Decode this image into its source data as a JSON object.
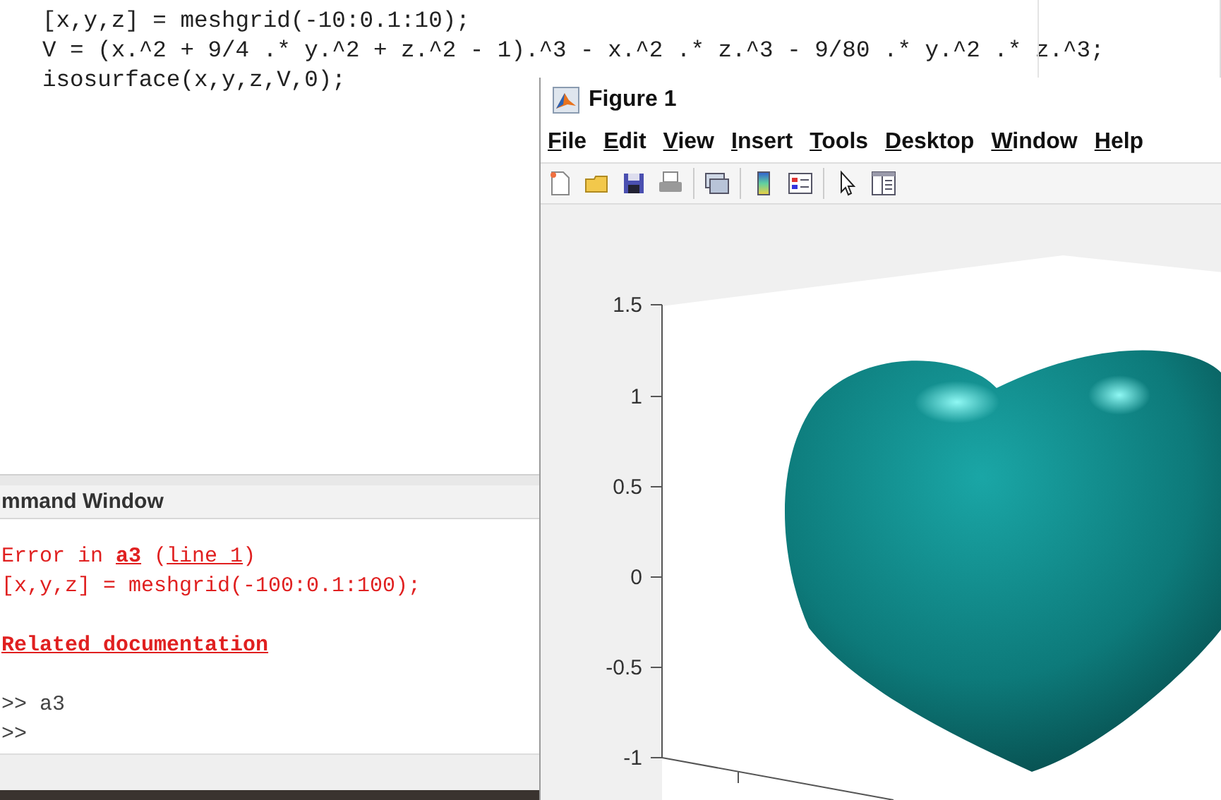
{
  "editor": {
    "lines": [
      "[x,y,z] = meshgrid(-10:0.1:10);",
      "V = (x.^2 + 9/4 .* y.^2 + z.^2 - 1).^3 - x.^2 .* z.^3 - 9/80 .* y.^2 .* z.^3;",
      "isosurface(x,y,z,V,0);"
    ]
  },
  "command_window": {
    "title": "mmand Window",
    "lines": [
      {
        "kind": "error",
        "segments": [
          {
            "text": "Error in ",
            "link": false,
            "bold": false
          },
          {
            "text": "a3",
            "link": true,
            "bold": true
          },
          {
            "text": " (",
            "link": false,
            "bold": false
          },
          {
            "text": "line 1",
            "link": true,
            "bold": false
          },
          {
            "text": ")",
            "link": false,
            "bold": false
          }
        ]
      },
      {
        "kind": "error",
        "segments": [
          {
            "text": "[x,y,z] = meshgrid(-100:0.1:100);",
            "link": false,
            "bold": false
          }
        ]
      },
      {
        "kind": "blank"
      },
      {
        "kind": "error",
        "segments": [
          {
            "text": "Related documentation",
            "link": true,
            "bold": true
          }
        ]
      },
      {
        "kind": "blank"
      },
      {
        "kind": "prompt",
        "segments": [
          {
            "text": ">> a3",
            "link": false,
            "bold": false
          }
        ]
      },
      {
        "kind": "prompt",
        "segments": [
          {
            "text": ">>",
            "link": false,
            "bold": false
          }
        ]
      }
    ]
  },
  "figure": {
    "title": "Figure 1",
    "menu": [
      "File",
      "Edit",
      "View",
      "Insert",
      "Tools",
      "Desktop",
      "Window",
      "Help"
    ],
    "axes": {
      "z_tick_labels": [
        "1.5",
        "1",
        "0.5",
        "0",
        "-0.5",
        "-1"
      ]
    }
  }
}
